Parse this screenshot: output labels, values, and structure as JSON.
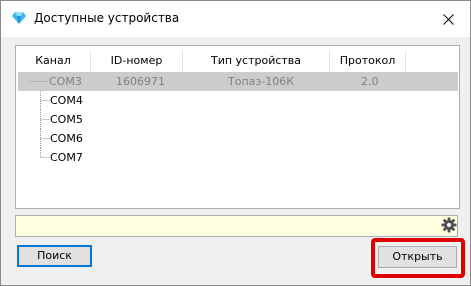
{
  "window": {
    "title": "Доступные устройства"
  },
  "table": {
    "columns": [
      "Канал",
      "ID-номер",
      "Тип устройства",
      "Протокол"
    ],
    "rows": [
      {
        "channel": "COM3",
        "id": "1606971",
        "type": "Топаз-106К",
        "protocol": "2.0",
        "selected": true
      },
      {
        "channel": "COM4",
        "id": "",
        "type": "",
        "protocol": ""
      },
      {
        "channel": "COM5",
        "id": "",
        "type": "",
        "protocol": ""
      },
      {
        "channel": "COM6",
        "id": "",
        "type": "",
        "protocol": ""
      },
      {
        "channel": "COM7",
        "id": "",
        "type": "",
        "protocol": ""
      }
    ]
  },
  "path_field": {
    "value": ""
  },
  "buttons": {
    "search": "Поиск",
    "open": "Открыть"
  },
  "colors": {
    "highlight": "#e00000",
    "selection": "#cccccc",
    "path_bg": "#ffffe1",
    "focus_border": "#0078d7"
  },
  "icons": {
    "app": "diamond-icon",
    "close": "close-icon",
    "settings": "gear-icon"
  }
}
